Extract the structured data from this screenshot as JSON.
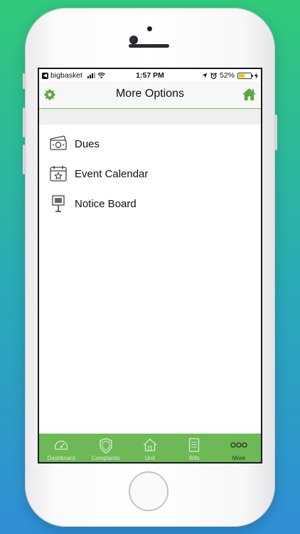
{
  "status_bar": {
    "back_app": "bigbasket",
    "time": "1:57 PM",
    "battery_percent": "52%",
    "battery_level": 0.52
  },
  "nav": {
    "title": "More Options",
    "left_icon": "gear-icon",
    "right_icon": "home-icon"
  },
  "menu": {
    "items": [
      {
        "label": "Dues",
        "icon": "money-icon"
      },
      {
        "label": "Event Calendar",
        "icon": "calendar-icon"
      },
      {
        "label": "Notice Board",
        "icon": "notice-board-icon"
      }
    ]
  },
  "tabs": [
    {
      "label": "Dashboard",
      "icon": "gauge-icon",
      "active": false
    },
    {
      "label": "Complaints",
      "icon": "shield-icon",
      "active": false
    },
    {
      "label": "Unit",
      "icon": "house-icon",
      "active": false
    },
    {
      "label": "Bills",
      "icon": "document-icon",
      "active": false
    },
    {
      "label": "More",
      "icon": "dots-icon",
      "active": true
    }
  ],
  "colors": {
    "accent_green": "#6cb956",
    "gear_green": "#5aa83f",
    "background_top": "#2fc97a",
    "background_bottom": "#2f8fd6"
  }
}
